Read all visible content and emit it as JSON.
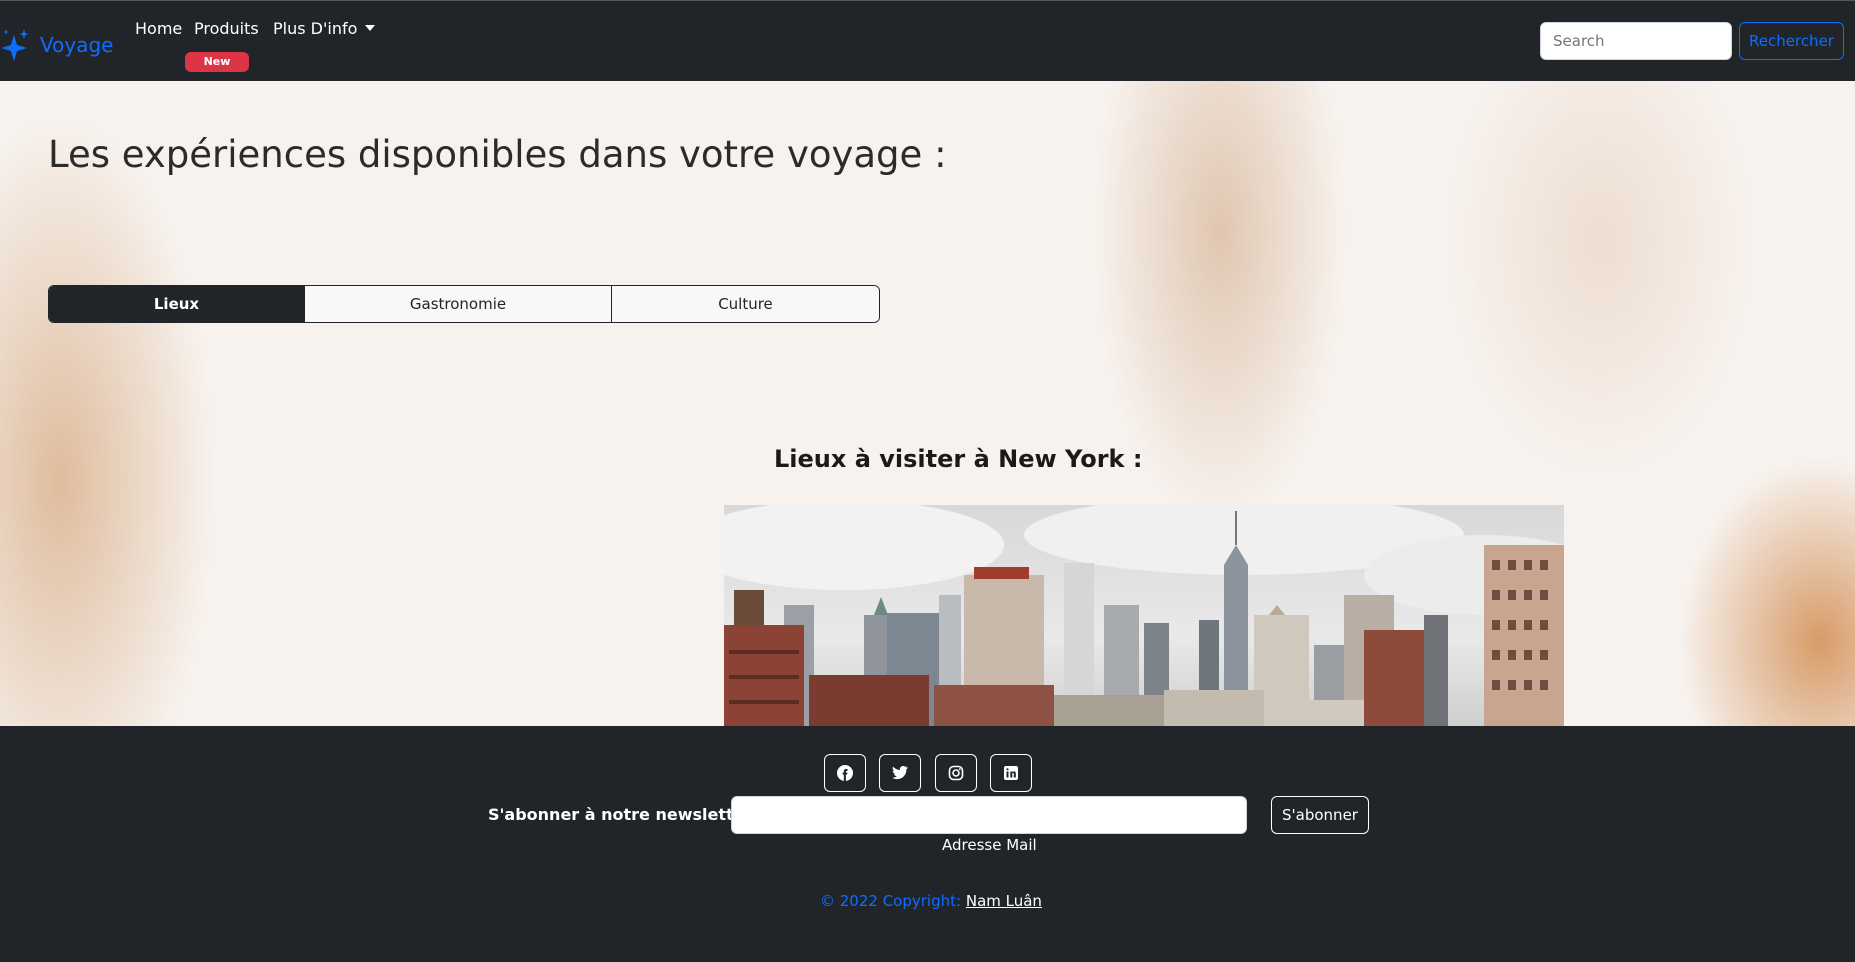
{
  "navbar": {
    "brand": "Voyage",
    "brand_icon": "sparkles-icon",
    "links": [
      {
        "label": "Home"
      },
      {
        "label": "Produits",
        "badge": "New"
      },
      {
        "label": "Plus D'info"
      }
    ],
    "search": {
      "placeholder": "Search"
    },
    "search_button": "Rechercher"
  },
  "main": {
    "title": "Les expériences disponibles dans votre voyage :",
    "tabs": [
      {
        "label": "Lieux",
        "active": true
      },
      {
        "label": "Gastronomie",
        "active": false
      },
      {
        "label": "Culture",
        "active": false
      }
    ],
    "section_heading": "Lieux à visiter à New York :"
  },
  "footer": {
    "social_icons": [
      "facebook-icon",
      "twitter-icon",
      "instagram-icon",
      "linkedin-icon"
    ],
    "newsletter_label": "S'abonner à notre newsletter",
    "email_label": "Adresse Mail",
    "subscribe_button": "S'abonner",
    "copyright_text": "© 2022 Copyright:",
    "copyright_link": "Nam Luân"
  },
  "colors": {
    "dark": "#212529",
    "primary": "#0d6efd",
    "danger": "#dc3545"
  }
}
